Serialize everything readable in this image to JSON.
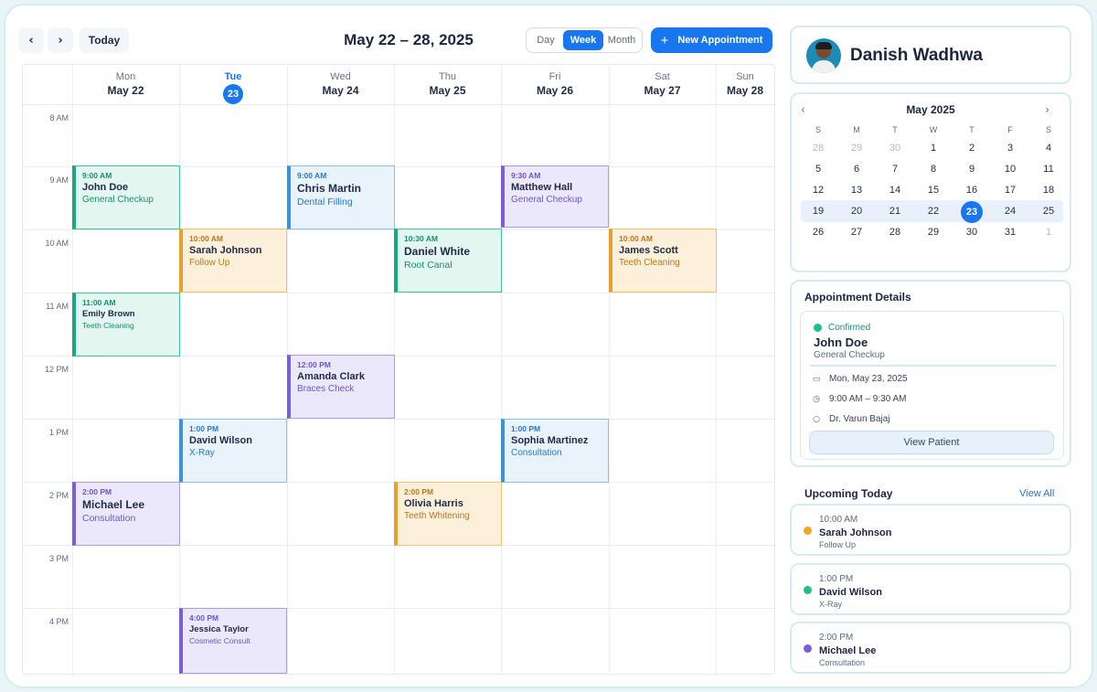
{
  "toolbar": {
    "prev_icon": "‹",
    "next_icon": "›",
    "today_label": "Today",
    "range_title": "May 22 – 28, 2025",
    "views": [
      "Day",
      "Week",
      "Month"
    ],
    "active_view": "Week",
    "new_appointment_icon": "+",
    "new_appointment_label": "New Appointment"
  },
  "week": {
    "days": [
      {
        "dow": "Mon",
        "date": "May 22"
      },
      {
        "dow": "Tue",
        "date": "23",
        "is_today": true
      },
      {
        "dow": "Wed",
        "date": "May 24"
      },
      {
        "dow": "Thu",
        "date": "May 25"
      },
      {
        "dow": "Fri",
        "date": "May 26"
      },
      {
        "dow": "Sat",
        "date": "May 27"
      },
      {
        "dow": "Sun",
        "date": "May 28"
      }
    ],
    "times": [
      "8 AM",
      "9 AM",
      "10 AM",
      "11 AM",
      "12 PM",
      "1 PM",
      "2 PM",
      "3 PM",
      "4 PM"
    ],
    "appointments": [
      {
        "day": "Mon",
        "time": "9:00 AM",
        "name": "John Doe",
        "type": "General Checkup",
        "color": "green"
      },
      {
        "day": "Tue",
        "time": "10:00 AM",
        "name": "Sarah Johnson",
        "type": "Follow Up",
        "color": "orange"
      },
      {
        "day": "Wed",
        "time": "9:00 AM",
        "name": "Chris Martin",
        "type": "Dental Filling",
        "color": "blue"
      },
      {
        "day": "Thu",
        "time": "10:30 AM",
        "name": "Daniel White",
        "type": "Root Canal",
        "color": "green"
      },
      {
        "day": "Fri",
        "time": "9:30 AM",
        "name": "Matthew Hall",
        "type": "General Checkup",
        "color": "purple"
      },
      {
        "day": "Sat",
        "time": "10:00 AM",
        "name": "James Scott",
        "type": "Teeth Cleaning",
        "color": "orange"
      },
      {
        "day": "Mon",
        "time": "11:00 AM",
        "name": "Emily Brown",
        "type": "Teeth Cleaning",
        "color": "green"
      },
      {
        "day": "Wed",
        "time": "12:00 PM",
        "name": "Amanda Clark",
        "type": "Braces Check",
        "color": "purple"
      },
      {
        "day": "Tue",
        "time": "1:00 PM",
        "name": "David Wilson",
        "type": "X-Ray",
        "color": "blue"
      },
      {
        "day": "Fri",
        "time": "1:00 PM",
        "name": "Sophia Martinez",
        "type": "Consultation",
        "color": "blue"
      },
      {
        "day": "Mon",
        "time": "2:00 PM",
        "name": "Michael Lee",
        "type": "Consultation",
        "color": "purple"
      },
      {
        "day": "Thu",
        "time": "2:00 PM",
        "name": "Olivia Harris",
        "type": "Teeth Whitening",
        "color": "orange"
      },
      {
        "day": "Tue",
        "time": "4:00 PM",
        "name": "Jessica Taylor",
        "type": "Cosmetic Consult",
        "color": "purple"
      }
    ]
  },
  "profile": {
    "name": "Danish Wadhwa",
    "avatar_icon": "user-avatar-icon"
  },
  "mini_calendar": {
    "title": "May 2025",
    "prev_icon": "‹",
    "next_icon": "›",
    "dows": [
      "S",
      "M",
      "T",
      "W",
      "T",
      "F",
      "S"
    ],
    "weeks": [
      [
        "28",
        "29",
        "30",
        "1",
        "2",
        "3",
        "4"
      ],
      [
        "5",
        "6",
        "7",
        "8",
        "9",
        "10",
        "11"
      ],
      [
        "12",
        "13",
        "14",
        "15",
        "16",
        "17",
        "18"
      ],
      [
        "19",
        "20",
        "21",
        "22",
        "23",
        "24",
        "25"
      ],
      [
        "26",
        "27",
        "28",
        "29",
        "30",
        "31",
        "1"
      ]
    ],
    "selected": "23"
  },
  "details": {
    "heading": "Appointment Details",
    "status": "Confirmed",
    "status_color": "#1fbf8f",
    "name": "John Doe",
    "type": "General Checkup",
    "date": "Mon, May 23, 2025",
    "time": "9:00 AM – 9:30 AM",
    "doctor": "Dr. Varun Bajaj",
    "button": "View Patient"
  },
  "upcoming": {
    "title": "Upcoming Today",
    "view_all": "View All",
    "items": [
      {
        "time": "10:00 AM",
        "name": "Sarah Johnson",
        "type": "Follow Up",
        "color": "#f2a51f"
      },
      {
        "time": "1:00 PM",
        "name": "David Wilson",
        "type": "X-Ray",
        "color": "#1fbf8f"
      },
      {
        "time": "2:00 PM",
        "name": "Michael Lee",
        "type": "Consultation",
        "color": "#7a5ed8"
      }
    ]
  }
}
